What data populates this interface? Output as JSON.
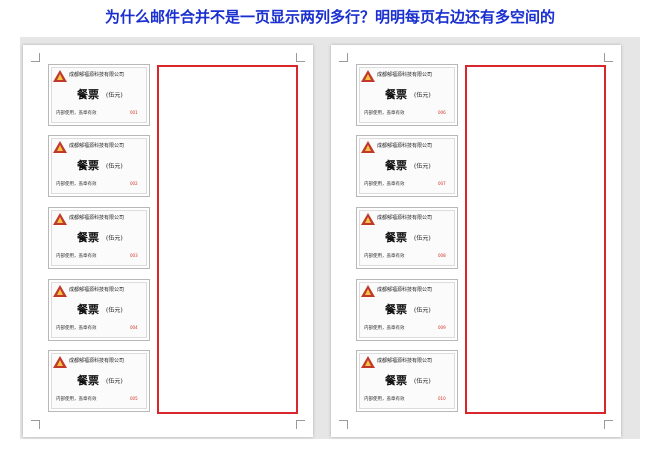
{
  "headline": "为什么邮件合并不是一页显示两列多行？明明每页右边还有多空间的",
  "colors": {
    "headline": "#1a2fd0",
    "frame": "#d8262c",
    "logo": "#c0392b"
  },
  "pages": [
    {
      "tickets": [
        {
          "company": "成都郁福源科技有限公司",
          "name": "餐票",
          "value": "(伍元)",
          "usage": "内部使用，盖章有效",
          "number": "001"
        },
        {
          "company": "成都郁福源科技有限公司",
          "name": "餐票",
          "value": "(伍元)",
          "usage": "内部使用，盖章有效",
          "number": "002"
        },
        {
          "company": "成都郁福源科技有限公司",
          "name": "餐票",
          "value": "(伍元)",
          "usage": "内部使用，盖章有效",
          "number": "003"
        },
        {
          "company": "成都郁福源科技有限公司",
          "name": "餐票",
          "value": "(伍元)",
          "usage": "内部使用，盖章有效",
          "number": "004"
        },
        {
          "company": "成都郁福源科技有限公司",
          "name": "餐票",
          "value": "(伍元)",
          "usage": "内部使用，盖章有效",
          "number": "005"
        }
      ]
    },
    {
      "tickets": [
        {
          "company": "成都郁福源科技有限公司",
          "name": "餐票",
          "value": "(伍元)",
          "usage": "内部使用，盖章有效",
          "number": "006"
        },
        {
          "company": "成都郁福源科技有限公司",
          "name": "餐票",
          "value": "(伍元)",
          "usage": "内部使用，盖章有效",
          "number": "007"
        },
        {
          "company": "成都郁福源科技有限公司",
          "name": "餐票",
          "value": "(伍元)",
          "usage": "内部使用，盖章有效",
          "number": "008"
        },
        {
          "company": "成都郁福源科技有限公司",
          "name": "餐票",
          "value": "(伍元)",
          "usage": "内部使用，盖章有效",
          "number": "009"
        },
        {
          "company": "成都郁福源科技有限公司",
          "name": "餐票",
          "value": "(伍元)",
          "usage": "内部使用，盖章有效",
          "number": "010"
        }
      ]
    }
  ]
}
